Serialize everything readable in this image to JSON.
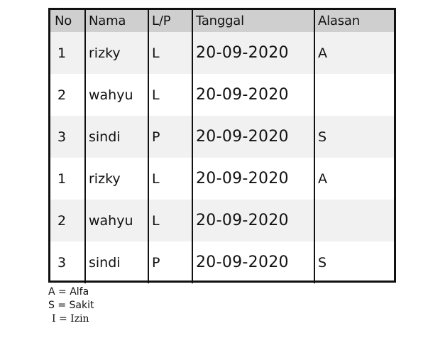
{
  "table": {
    "headers": [
      "No",
      "Nama",
      "L/P",
      "Tanggal",
      "Alasan"
    ],
    "rows": [
      {
        "no": "1",
        "nama": "rizky",
        "lp": "L",
        "tanggal": "20-09-2020",
        "alasan": "A"
      },
      {
        "no": "2",
        "nama": "wahyu",
        "lp": "L",
        "tanggal": "20-09-2020",
        "alasan": ""
      },
      {
        "no": "3",
        "nama": "sindi",
        "lp": "P",
        "tanggal": "20-09-2020",
        "alasan": "S"
      },
      {
        "no": "1",
        "nama": "rizky",
        "lp": "L",
        "tanggal": "20-09-2020",
        "alasan": "A"
      },
      {
        "no": "2",
        "nama": "wahyu",
        "lp": "L",
        "tanggal": "20-09-2020",
        "alasan": ""
      },
      {
        "no": "3",
        "nama": "sindi",
        "lp": "P",
        "tanggal": "20-09-2020",
        "alasan": "S"
      }
    ]
  },
  "legend": [
    "A = Alfa",
    "S = Sakit",
    "I = Izin"
  ],
  "colors": {
    "header_bg": "#cfcfcf",
    "shaded_row_bg": "#f1f1f1",
    "border": "#111111"
  }
}
